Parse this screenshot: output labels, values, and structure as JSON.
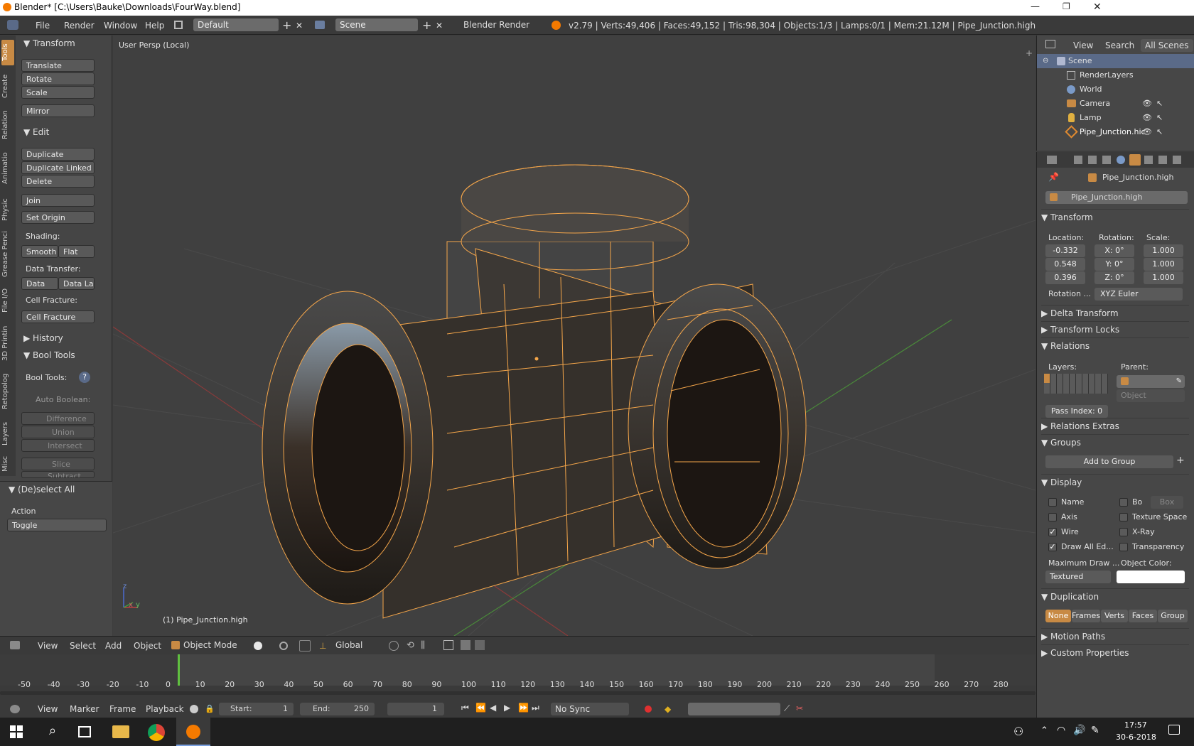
{
  "window": {
    "title": "Blender* [C:\\Users\\Bauke\\Downloads\\FourWay.blend]",
    "minimize": "🗕",
    "maximize": "🗗",
    "close": "✕"
  },
  "infobar": {
    "menus": [
      "File",
      "Render",
      "Window",
      "Help"
    ],
    "layout": "Default",
    "scene": "Scene",
    "engine": "Blender Render",
    "stats": "v2.79 | Verts:49,406 | Faces:49,152 | Tris:98,304 | Objects:1/3 | Lamps:0/1 | Mem:21.12M | Pipe_Junction.high"
  },
  "tabs": [
    "Tools",
    "Create",
    "Relation",
    "Animatio",
    "Physic",
    "Grease Penci",
    "File I/O",
    "3D Printin",
    "Retopolog",
    "Layers",
    "Misc"
  ],
  "toolshelf": {
    "transform_hdr": "Transform",
    "translate": "Translate",
    "rotate": "Rotate",
    "scale": "Scale",
    "mirror": "Mirror",
    "edit_hdr": "Edit",
    "duplicate": "Duplicate",
    "duplicate_linked": "Duplicate Linked",
    "delete": "Delete",
    "join": "Join",
    "set_origin": "Set Origin",
    "shading": "Shading:",
    "smooth": "Smooth",
    "flat": "Flat",
    "data_transfer": "Data Transfer:",
    "data": "Data",
    "data_la": "Data La",
    "cell_fracture_lbl": "Cell Fracture:",
    "cell_fracture": "Cell Fracture",
    "history_hdr": "History",
    "bool_tools_hdr": "Bool Tools",
    "bool_tools_lbl": "Bool Tools:",
    "auto_boolean": "Auto Boolean:",
    "difference": "Difference",
    "union": "Union",
    "intersect": "Intersect",
    "slice": "Slice",
    "subtract": "Subtract",
    "deselect_hdr": "(De)select All",
    "action": "Action",
    "toggle": "Toggle"
  },
  "viewport": {
    "view_label": "User Persp (Local)",
    "object_label": "(1) Pipe_Junction.high",
    "axis_z": "z",
    "axis_x": "x",
    "axis_y": "y"
  },
  "vpheader": {
    "view": "View",
    "select": "Select",
    "add": "Add",
    "object": "Object",
    "mode": "Object Mode",
    "orientation": "Global"
  },
  "timeline": {
    "ticks": [
      "-50",
      "-40",
      "-30",
      "-20",
      "-10",
      "0",
      "10",
      "20",
      "30",
      "40",
      "50",
      "60",
      "70",
      "80",
      "90",
      "100",
      "110",
      "120",
      "130",
      "140",
      "150",
      "160",
      "170",
      "180",
      "190",
      "200",
      "210",
      "220",
      "230",
      "240",
      "250",
      "260",
      "270",
      "280"
    ],
    "view": "View",
    "marker": "Marker",
    "frame": "Frame",
    "playback": "Playback",
    "start_label": "Start:",
    "start": "1",
    "end_label": "End:",
    "end": "250",
    "current": "1",
    "sync": "No Sync"
  },
  "outliner": {
    "view": "View",
    "search": "Search",
    "all_scenes": "All Scenes",
    "rows": [
      "Scene",
      "RenderLayers",
      "World",
      "Camera",
      "Lamp",
      "Pipe_Junction.hic"
    ]
  },
  "props": {
    "object_path": "Pipe_Junction.high",
    "object_name": "Pipe_Junction.high",
    "transform_hdr": "Transform",
    "location_lbl": "Location:",
    "rotation_lbl": "Rotation:",
    "scale_lbl": "Scale:",
    "loc": [
      "-0.332",
      "0.548",
      "0.396"
    ],
    "rot": [
      "X:  0°",
      "Y:  0°",
      "Z:  0°"
    ],
    "scl": [
      "1.000",
      "1.000",
      "1.000"
    ],
    "rotation_mode_lbl": "Rotation ...",
    "rotation_mode": "XYZ Euler",
    "delta_transform": "Delta Transform",
    "transform_locks": "Transform Locks",
    "relations_hdr": "Relations",
    "layers_lbl": "Layers:",
    "parent_lbl": "Parent:",
    "parent_type": "Object",
    "pass_index": "Pass Index:  0",
    "relations_extras": "Relations Extras",
    "groups_hdr": "Groups",
    "add_to_group": "Add to Group",
    "display_hdr": "Display",
    "name": "Name",
    "bo": "Bo",
    "box": "Box",
    "axis": "Axis",
    "texture_space": "Texture Space",
    "wire": "Wire",
    "xray": "X-Ray",
    "draw_all_edges": "Draw All Ed...",
    "transparency": "Transparency",
    "max_draw_lbl": "Maximum Draw ...",
    "object_color_lbl": "Object Color:",
    "max_draw": "Textured",
    "duplication_hdr": "Duplication",
    "dup_opts": [
      "None",
      "Frames",
      "Verts",
      "Faces",
      "Group"
    ],
    "motion_paths": "Motion Paths",
    "custom_properties": "Custom Properties"
  },
  "taskbar": {
    "time": "17:57",
    "date": "30-6-2018"
  },
  "colors": {
    "accent": "#f0a050",
    "wire": "#f5a64a",
    "selected_row": "#5a6a88"
  }
}
